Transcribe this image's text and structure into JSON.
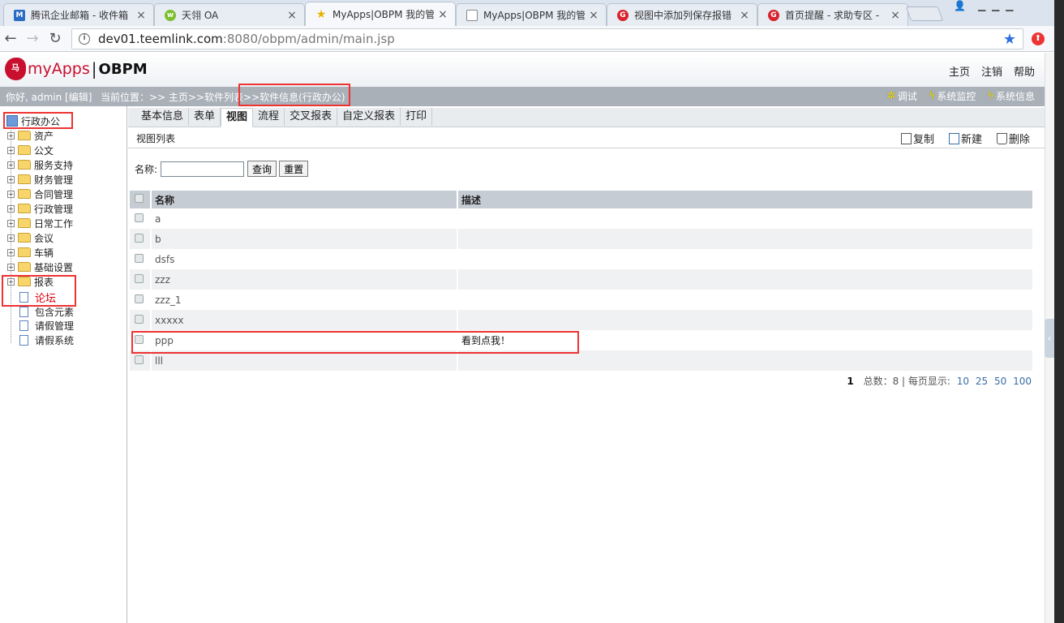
{
  "browser": {
    "tabs": [
      {
        "title": "腾讯企业邮箱 - 收件箱",
        "fav": "M",
        "fav_color": "#2b6cc4"
      },
      {
        "title": "天翎 OA",
        "fav": "w",
        "fav_color": "#7cbf2e"
      },
      {
        "title": "MyApps|OBPM 我的管",
        "fav": "★",
        "fav_color": "#e8b400"
      },
      {
        "title": "MyApps|OBPM 我的管",
        "fav": "",
        "fav_color": "#ffffff"
      },
      {
        "title": "视图中添加列保存报错",
        "fav": "G",
        "fav_color": "#d9232d"
      },
      {
        "title": "首页提醒 - 求助专区 -",
        "fav": "G",
        "fav_color": "#d9232d"
      }
    ],
    "url_host": "dev01.teemlink.com",
    "url_rest": ":8080/obpm/admin/main.jsp"
  },
  "app": {
    "logo_text": "myApps",
    "logo_sep": "|",
    "logo_text2": "OBPM",
    "topnav": [
      "主页",
      "注销",
      "帮助"
    ],
    "greeting": "你好, admin [编辑]",
    "breadcrumb": "当前位置：>> 主页>>软件列表>>软件信息(行政办公)",
    "tools": [
      "调试",
      "系统监控",
      "系统信息"
    ]
  },
  "tree": {
    "root": "行政办公",
    "folders": [
      "资产",
      "公文",
      "服务支持",
      "财务管理",
      "合同管理",
      "行政管理",
      "日常工作",
      "会议",
      "车辆",
      "基础设置",
      "报表"
    ],
    "docs": [
      "论坛",
      "包含元素",
      "请假管理",
      "请假系统"
    ]
  },
  "main": {
    "tabs": [
      "基本信息",
      "表单",
      "视图",
      "流程",
      "交叉报表",
      "自定义报表",
      "打印"
    ],
    "active_tab": 2,
    "subtitle": "视图列表",
    "actions": [
      "复制",
      "新建",
      "删除"
    ],
    "search_label": "名称:",
    "search_value": "",
    "query_btn": "查询",
    "reset_btn": "重置",
    "columns": [
      "名称",
      "描述"
    ],
    "rows": [
      {
        "name": "a",
        "desc": ""
      },
      {
        "name": "b",
        "desc": ""
      },
      {
        "name": "dsfs",
        "desc": ""
      },
      {
        "name": "zzz",
        "desc": ""
      },
      {
        "name": "zzz_1",
        "desc": ""
      },
      {
        "name": "xxxxx",
        "desc": ""
      },
      {
        "name": "ppp",
        "desc": "看到点我！"
      },
      {
        "name": "lll",
        "desc": ""
      }
    ],
    "pager": {
      "current": "1",
      "total_text": "总数：8 | 每页显示:",
      "sizes": [
        "10",
        "25",
        "50",
        "100"
      ]
    }
  }
}
